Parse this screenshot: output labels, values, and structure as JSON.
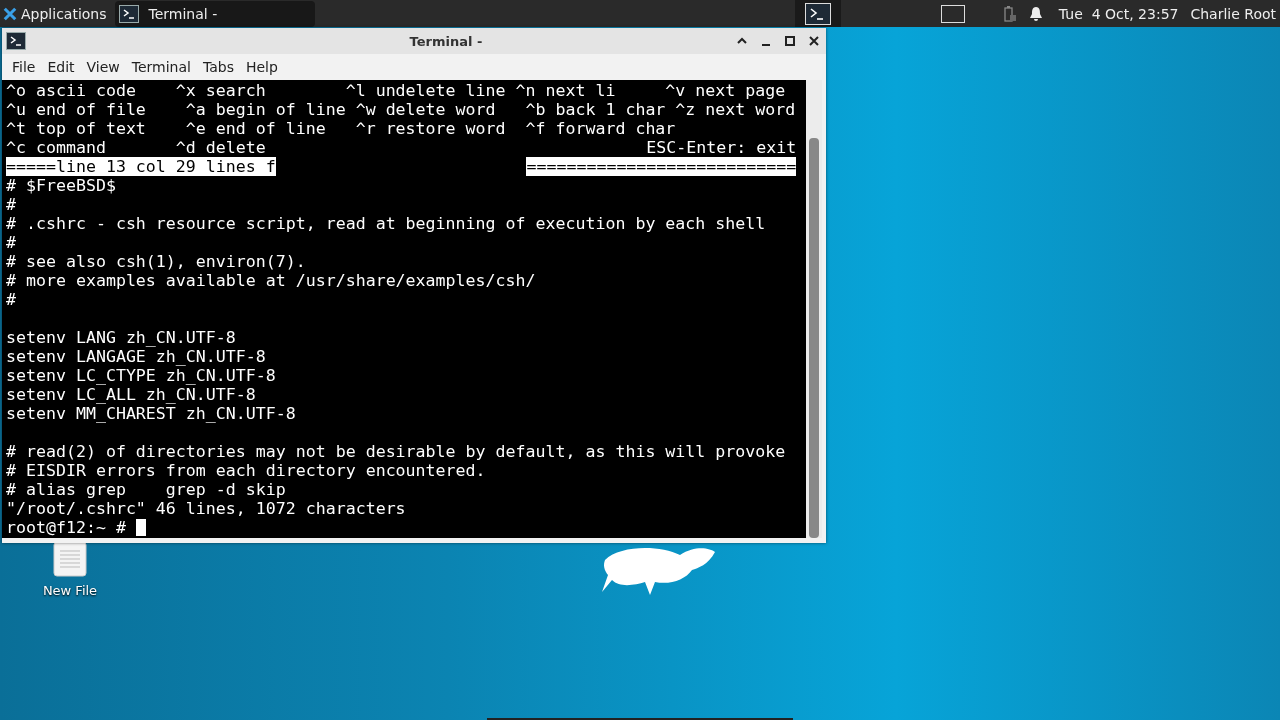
{
  "panel": {
    "applications": "Applications",
    "task": {
      "label": "Terminal -",
      "selected": true
    },
    "clock": "Tue  4 Oct, 23:57",
    "user": "Charlie Root"
  },
  "window": {
    "title": "Terminal -",
    "menu": [
      "File",
      "Edit",
      "View",
      "Terminal",
      "Tabs",
      "Help"
    ],
    "lines": [
      {
        "kind": "text",
        "text": "^o ascii code    ^x search        ^l undelete line ^n next li     ^v next page"
      },
      {
        "kind": "text",
        "text": "^u end of file    ^a begin of line ^w delete word   ^b back 1 char ^z next word"
      },
      {
        "kind": "text",
        "text": "^t top of text    ^e end of line   ^r restore word  ^f forward char"
      },
      {
        "kind": "split",
        "left": "^c command       ^d delete",
        "right": "ESC-Enter: exit"
      },
      {
        "kind": "status",
        "left": "=====line 13 col 29 lines f",
        "right": "==========================="
      },
      {
        "kind": "text",
        "text": "# $FreeBSD$"
      },
      {
        "kind": "text",
        "text": "#"
      },
      {
        "kind": "text",
        "text": "# .cshrc - csh resource script, read at beginning of execution by each shell"
      },
      {
        "kind": "text",
        "text": "#"
      },
      {
        "kind": "text",
        "text": "# see also csh(1), environ(7)."
      },
      {
        "kind": "text",
        "text": "# more examples available at /usr/share/examples/csh/"
      },
      {
        "kind": "text",
        "text": "#"
      },
      {
        "kind": "blank"
      },
      {
        "kind": "text",
        "text": "setenv LANG zh_CN.UTF-8"
      },
      {
        "kind": "text",
        "text": "setenv LANGAGE zh_CN.UTF-8"
      },
      {
        "kind": "text",
        "text": "setenv LC_CTYPE zh_CN.UTF-8"
      },
      {
        "kind": "text",
        "text": "setenv LC_ALL zh_CN.UTF-8"
      },
      {
        "kind": "text",
        "text": "setenv MM_CHAREST zh_CN.UTF-8"
      },
      {
        "kind": "blank"
      },
      {
        "kind": "text",
        "text": "# read(2) of directories may not be desirable by default, as this will provoke"
      },
      {
        "kind": "text",
        "text": "# EISDIR errors from each directory encountered."
      },
      {
        "kind": "text",
        "text": "# alias grep    grep -d skip"
      },
      {
        "kind": "text",
        "text": "\"/root/.cshrc\" 46 lines, 1072 characters"
      },
      {
        "kind": "prompt",
        "text": "root@f12:~ #"
      }
    ]
  },
  "desktop": {
    "icons": [
      {
        "label": "New File"
      }
    ]
  }
}
